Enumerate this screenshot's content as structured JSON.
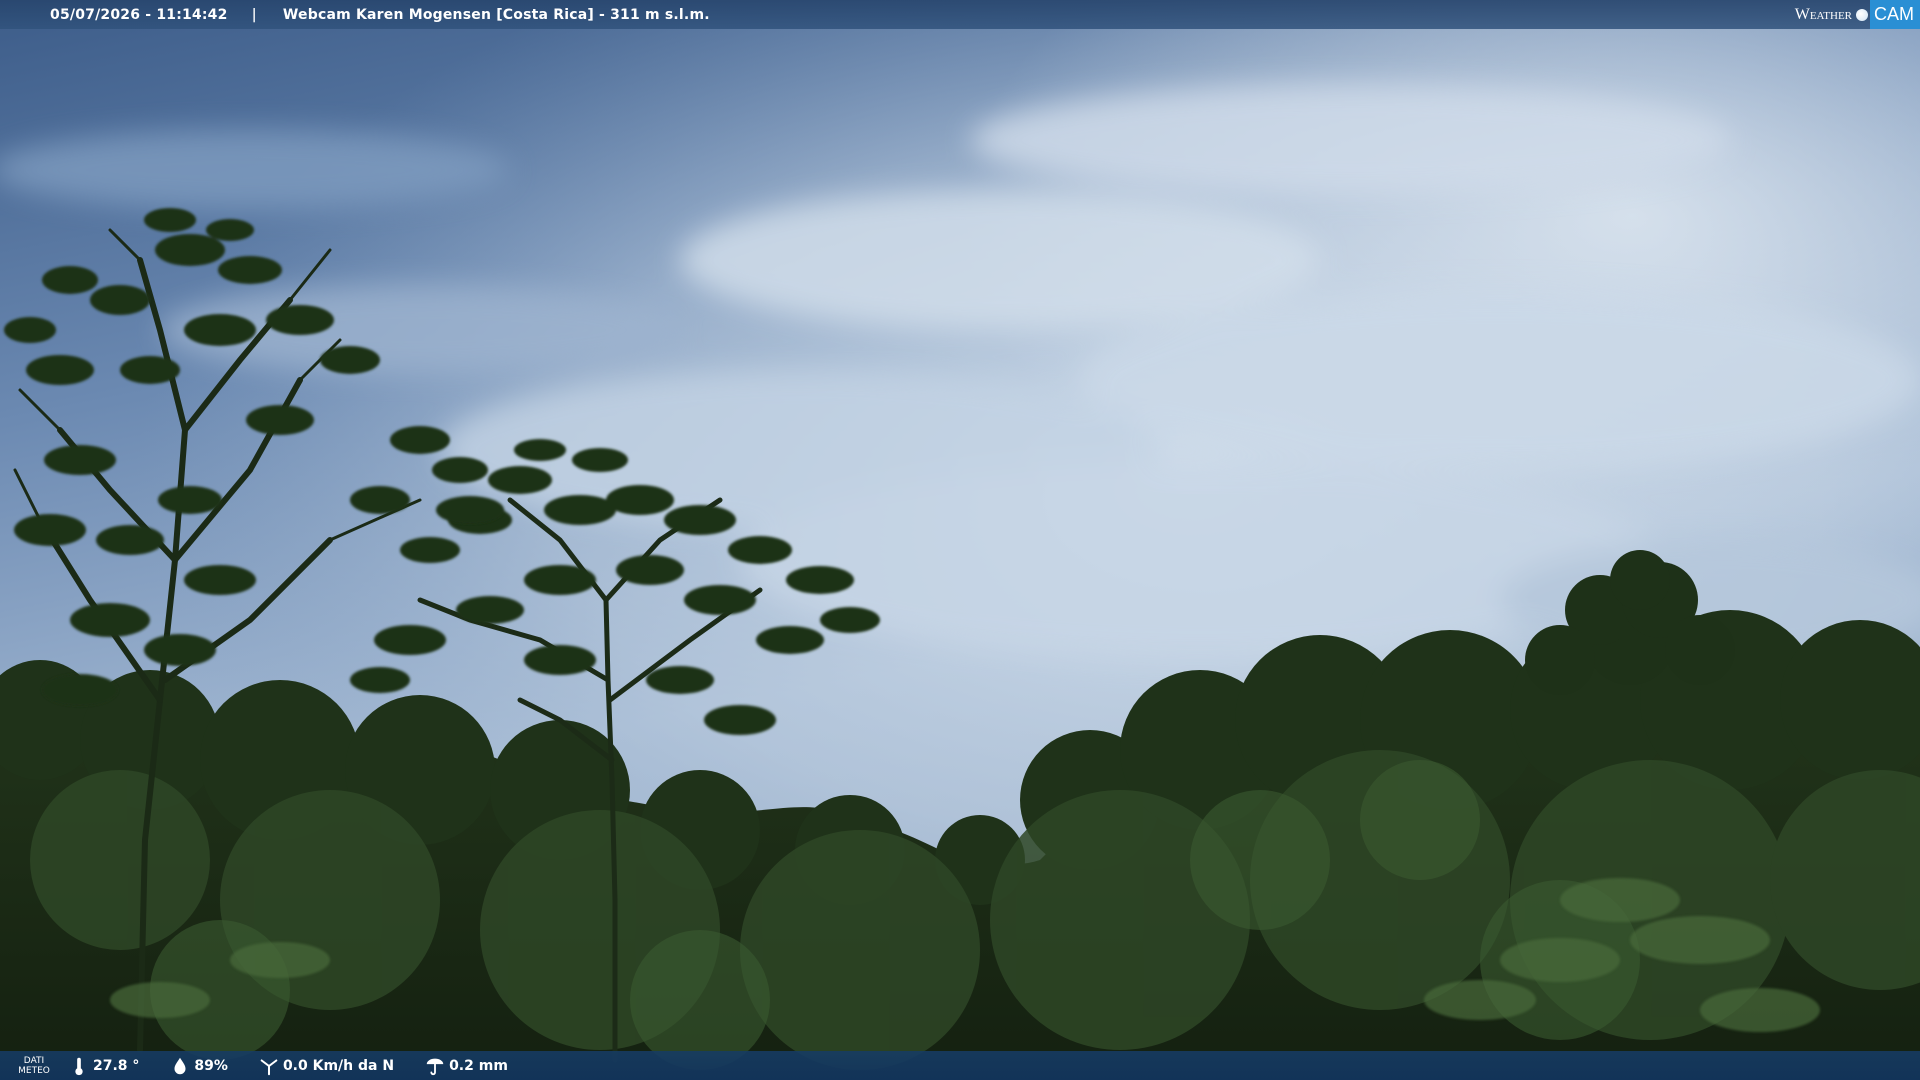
{
  "overlay": {
    "timestamp": "05/07/2026 - 11:14:42",
    "separator": "|",
    "title": "Webcam Karen Mogensen [Costa Rica] - 311 m s.l.m."
  },
  "brand": {
    "weather": "Weather",
    "cam": "CAM",
    "accent_color": "#2a8fd4"
  },
  "meteo": {
    "label_line1": "DATI",
    "label_line2": "METEO",
    "temperature": "27.8 °",
    "humidity": "89%",
    "wind": "0.0 Km/h da N",
    "rain": "0.2 mm",
    "icons": [
      "thermometer-icon",
      "humidity-drop-icon",
      "wind-icon",
      "rain-gauge-icon"
    ]
  },
  "colors": {
    "sky_top": "#3e5f8c",
    "sky_mid": "#8ea8c8",
    "sky_light": "#c8d6e6",
    "foliage_dark": "#14230f",
    "foliage_mid": "#2c4222",
    "bar_blue": "#1e4a78"
  }
}
